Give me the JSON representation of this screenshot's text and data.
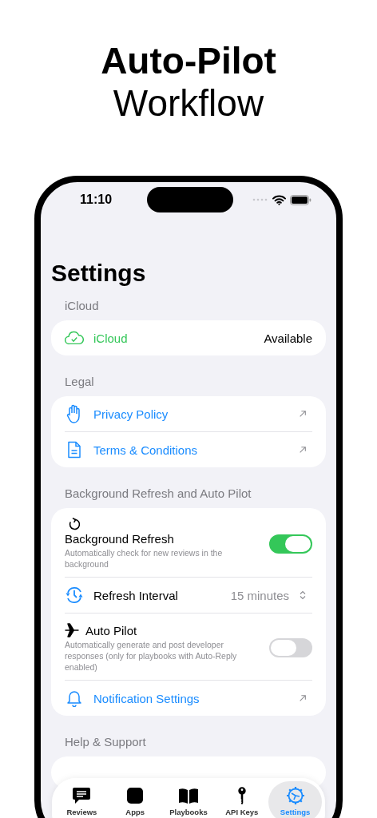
{
  "headline": {
    "line_1": "Auto-Pilot",
    "line_2": "Workflow"
  },
  "status_bar": {
    "time": "11:10"
  },
  "title": "Settings",
  "sections": [
    {
      "header": "iCloud",
      "rows": [
        {
          "kind": "status",
          "label": "iCloud",
          "value": "Available"
        }
      ]
    },
    {
      "header": "Legal",
      "rows": [
        {
          "kind": "link",
          "label": "Privacy Policy"
        },
        {
          "kind": "link",
          "label": "Terms & Conditions"
        }
      ]
    },
    {
      "header": "Background Refresh and Auto Pilot",
      "rows": [
        {
          "kind": "toggle",
          "label": "Background Refresh",
          "description": "Automatically check for new reviews in the background",
          "on": true
        },
        {
          "kind": "picker",
          "label": "Refresh Interval",
          "value": "15 minutes"
        },
        {
          "kind": "toggle",
          "label": "Auto Pilot",
          "description": "Automatically generate and post developer responses (only for playbooks with Auto-Reply enabled)",
          "on": false
        },
        {
          "kind": "link",
          "label": "Notification Settings"
        }
      ]
    },
    {
      "header": "Help & Support"
    }
  ],
  "tabs": [
    {
      "label": "Reviews",
      "selected": false
    },
    {
      "label": "Apps",
      "selected": false
    },
    {
      "label": "Playbooks",
      "selected": false
    },
    {
      "label": "API Keys",
      "selected": false
    },
    {
      "label": "Settings",
      "selected": true
    }
  ]
}
